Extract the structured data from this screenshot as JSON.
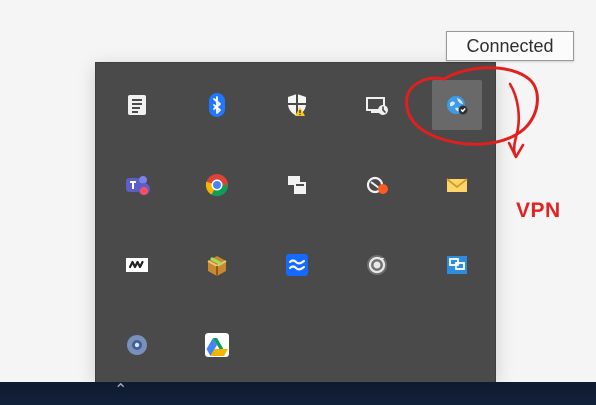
{
  "tooltip": {
    "text": "Connected"
  },
  "annotation": {
    "label": "VPN",
    "color": "#e22323"
  },
  "tray": {
    "items": [
      {
        "name": "notes-icon",
        "row": 0,
        "col": 0,
        "selected": false
      },
      {
        "name": "bluetooth-icon",
        "row": 0,
        "col": 1,
        "selected": false
      },
      {
        "name": "security-warning-icon",
        "row": 0,
        "col": 2,
        "selected": false
      },
      {
        "name": "remote-display-icon",
        "row": 0,
        "col": 3,
        "selected": false
      },
      {
        "name": "vpn-globe-icon",
        "row": 0,
        "col": 4,
        "selected": true
      },
      {
        "name": "teams-icon",
        "row": 1,
        "col": 0,
        "selected": false
      },
      {
        "name": "chrome-icon",
        "row": 1,
        "col": 1,
        "selected": false
      },
      {
        "name": "windows-pair-icon",
        "row": 1,
        "col": 2,
        "selected": false
      },
      {
        "name": "recording-icon",
        "row": 1,
        "col": 3,
        "selected": false
      },
      {
        "name": "mail-icon",
        "row": 1,
        "col": 4,
        "selected": false
      },
      {
        "name": "wave-logo-icon",
        "row": 2,
        "col": 0,
        "selected": false
      },
      {
        "name": "package-icon",
        "row": 2,
        "col": 1,
        "selected": false
      },
      {
        "name": "sync-waves-icon",
        "row": 2,
        "col": 2,
        "selected": false
      },
      {
        "name": "circular-arrow-icon",
        "row": 2,
        "col": 3,
        "selected": false
      },
      {
        "name": "screens-icon",
        "row": 2,
        "col": 4,
        "selected": false
      },
      {
        "name": "settings-orb-icon",
        "row": 3,
        "col": 0,
        "selected": false
      },
      {
        "name": "google-drive-icon",
        "row": 3,
        "col": 1,
        "selected": false
      }
    ]
  }
}
